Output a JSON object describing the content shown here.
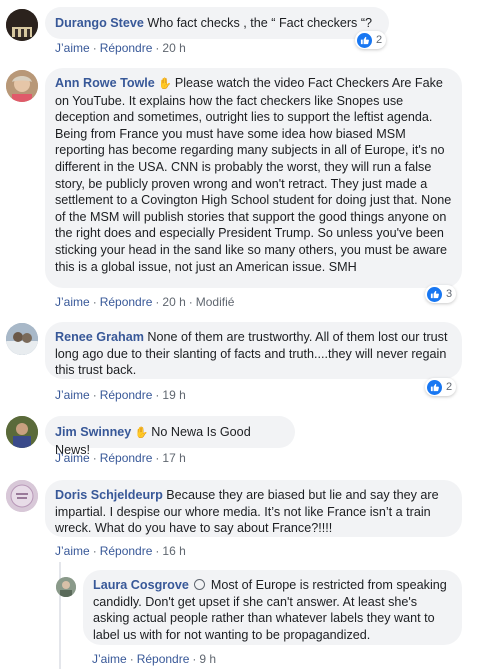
{
  "comments": [
    {
      "author": "Durango Steve",
      "text": "Who fact checks , the “ Fact checkers “?",
      "like": "J’aime",
      "reply": "Répondre",
      "time": "20 h",
      "reactions": "2",
      "avatar_color": "#3a2f2a"
    },
    {
      "author": "Ann Rowe Towle",
      "text": "Please watch the video Fact Checkers Are Fake on YouTube. It explains how the fact checkers like Snopes use deception and sometimes, outright lies to support the leftist agenda. Being from France you must have some idea how biased MSM reporting has become regarding many subjects in all of Europe, it's no different in the USA. CNN is probably the worst, they will run a false story, be publicly proven wrong and won't retract. They just made a settlement to a Covington High School student for doing just that. None of the MSM will publish stories that support the good things anyone on the right does and especially President Trump. So unless you've been sticking your head in the sand like so many others, you must be aware this is a global issue, not just an American issue. SMH",
      "like": "J’aime",
      "reply": "Répondre",
      "time": "20 h",
      "edited": "Modifié",
      "reactions": "3",
      "avatar_color": "#c9a27f"
    },
    {
      "author": "Renee Graham",
      "text": "None of them are trustworthy. All of them lost our trust long ago due to their slanting of facts and truth....they will never regain this trust back.",
      "like": "J’aime",
      "reply": "Répondre",
      "time": "19 h",
      "reactions": "2",
      "avatar_color": "#8fa3b8"
    },
    {
      "author": "Jim Swinney",
      "text": "No Newa Is Good News!",
      "like": "J’aime",
      "reply": "Répondre",
      "time": "17 h",
      "avatar_color": "#6a7a3e"
    },
    {
      "author": "Doris Schjeldeurp",
      "text": "Because they are biased but lie and say they are impartial. I despise our whore media. It’s not like France isn’t a train wreck. What do you have to say about France?!!!!",
      "like": "J’aime",
      "reply": "Répondre",
      "time": "16 h",
      "avatar_color": "#c9b3c6"
    }
  ],
  "reply": {
    "author": "Laura Cosgrove",
    "text": "Most of Europe is restricted from speaking candidly. Don't get upset if she can't answer. At least she's asking actual people rather than whatever labels they want to label us with for not wanting to be propagandized.",
    "like": "J’aime",
    "reply": "Répondre",
    "time": "9 h",
    "avatar_color": "#9aa29a"
  },
  "colors": {
    "link": "#385898",
    "bubble": "#f2f3f5",
    "like_blue": "#1877f2",
    "meta": "#606770"
  },
  "icons": {
    "wave": "waving-hand-icon",
    "like": "thumbs-up-icon",
    "badge": "verified-badge-icon"
  }
}
